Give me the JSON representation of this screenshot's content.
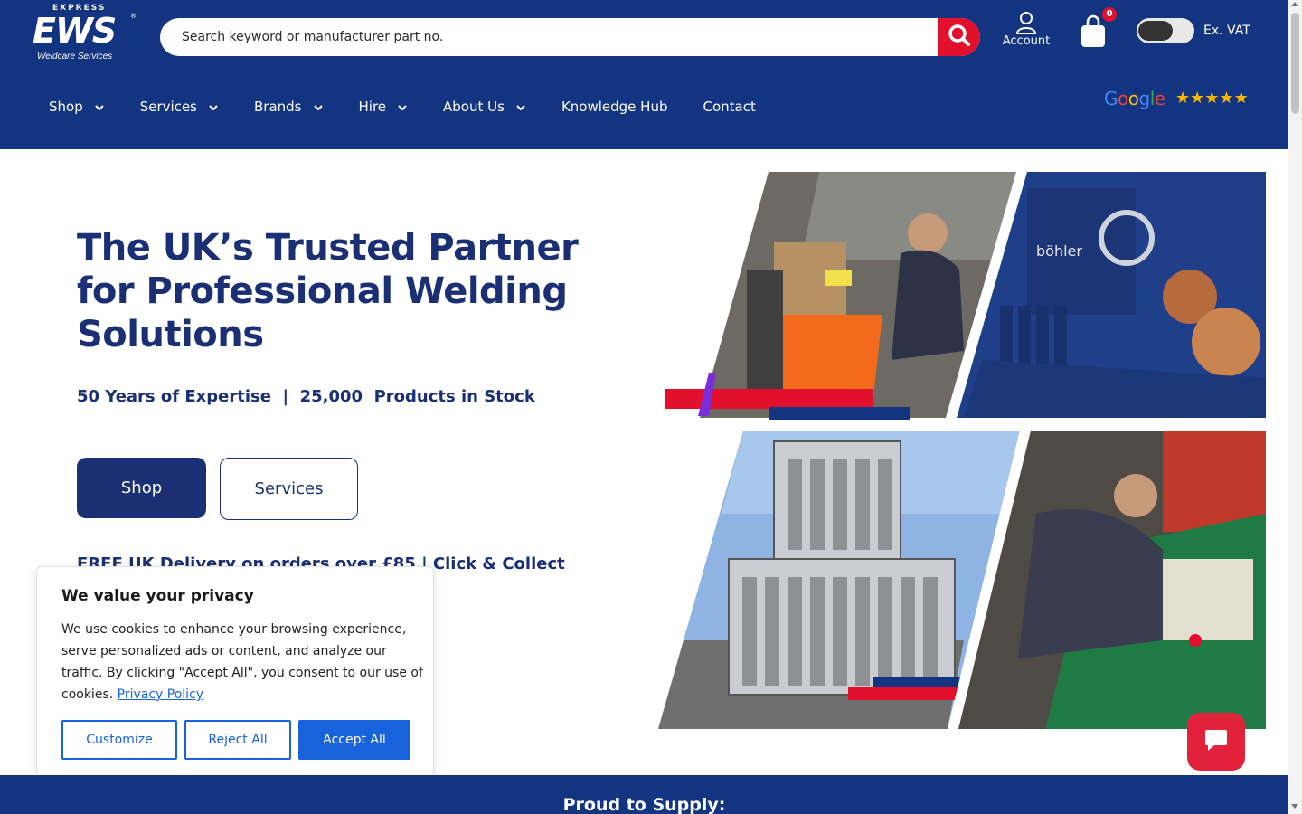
{
  "header": {
    "logo": {
      "express": "EXPRESS",
      "ews": "EWS",
      "subtitle": "Weldcare Services"
    },
    "search": {
      "placeholder": "Search keyword or manufacturer part no."
    },
    "account_label": "Account",
    "cart_count": "0",
    "vat_label": "Ex. VAT",
    "nav": [
      {
        "label": "Shop",
        "dropdown": true
      },
      {
        "label": "Services",
        "dropdown": true
      },
      {
        "label": "Brands",
        "dropdown": true
      },
      {
        "label": "Hire",
        "dropdown": true
      },
      {
        "label": "About Us",
        "dropdown": true
      },
      {
        "label": "Knowledge Hub",
        "dropdown": false
      },
      {
        "label": "Contact",
        "dropdown": false
      }
    ],
    "google": "Google",
    "rating_stars": 5
  },
  "hero": {
    "title": "The UK’s Trusted Partner for Professional Welding Solutions",
    "stats": "50 Years of Expertise  |  25,000  Products in Stock",
    "shop_button": "Shop",
    "services_button": "Services",
    "delivery": "FREE UK Delivery on orders over £85 | Click & Collect"
  },
  "images": {
    "top_left": "welder-working-machine",
    "top_right": "bohler-welding-products",
    "bottom_left": "gas-cylinder-racks",
    "bottom_right": "technician-repairing-machine",
    "bohler_brand": "böhler"
  },
  "cookie": {
    "title": "We value your privacy",
    "body": "We use cookies to enhance your browsing experience, serve personalized ads or content, and analyze our traffic. By clicking \"Accept All\", you consent to our use of cookies.",
    "privacy_link": "Privacy Policy",
    "customize": "Customize",
    "reject": "Reject All",
    "accept": "Accept All"
  },
  "supply_strip": {
    "text": "Proud to Supply:"
  },
  "colors": {
    "brand_blue": "#133581",
    "accent_red": "#e2102d",
    "cookie_blue": "#1863dc"
  }
}
